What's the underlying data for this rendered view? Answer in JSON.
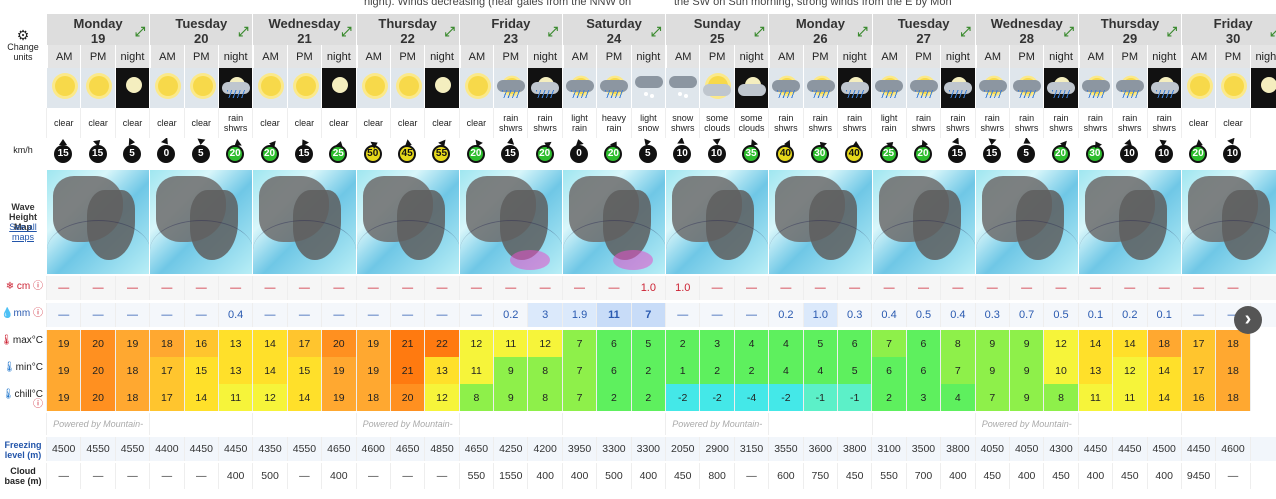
{
  "top_text": [
    {
      "text": "night). Winds decreasing (near gales from the NNW on",
      "x": 0
    },
    {
      "text": "the SW on Sun morning, strong winds from the E by Mon",
      "x": 0
    }
  ],
  "labels": {
    "change_units": "Change units",
    "wind": "km/h",
    "wave_map": "Wave Height Map",
    "see_all": "See all maps",
    "snow": "cm",
    "rain": "mm",
    "max": "max°C",
    "min": "min°C",
    "chill": "chill°C",
    "freezing": "Freezing level (m)",
    "cloud_base": "Cloud base (m)",
    "powered": "Powered by Mountain-Forecast.com",
    "tod": [
      "AM",
      "PM",
      "night"
    ]
  },
  "days": [
    {
      "name": "Monday",
      "date": "19"
    },
    {
      "name": "Tuesday",
      "date": "20"
    },
    {
      "name": "Wednesday",
      "date": "21"
    },
    {
      "name": "Thursday",
      "date": "22"
    },
    {
      "name": "Friday",
      "date": "23"
    },
    {
      "name": "Saturday",
      "date": "24"
    },
    {
      "name": "Sunday",
      "date": "25"
    },
    {
      "name": "Monday",
      "date": "26"
    },
    {
      "name": "Tuesday",
      "date": "27"
    },
    {
      "name": "Wednesday",
      "date": "28"
    },
    {
      "name": "Thursday",
      "date": "29"
    },
    {
      "name": "Friday",
      "date": "30"
    }
  ],
  "periods": [
    {
      "icon": "sun",
      "desc": "clear",
      "wind": "15",
      "snow": "—",
      "rain": "—",
      "max": "19",
      "min": "19",
      "chill": "19",
      "fz": "4500",
      "cb": "—"
    },
    {
      "icon": "sun",
      "desc": "clear",
      "wind": "15",
      "snow": "—",
      "rain": "—",
      "max": "20",
      "min": "20",
      "chill": "20",
      "fz": "4550",
      "cb": "—"
    },
    {
      "icon": "moon",
      "desc": "clear",
      "wind": "5",
      "snow": "—",
      "rain": "—",
      "max": "19",
      "min": "18",
      "chill": "18",
      "fz": "4550",
      "cb": "—"
    },
    {
      "icon": "sun",
      "desc": "clear",
      "wind": "0",
      "snow": "—",
      "rain": "—",
      "max": "18",
      "min": "17",
      "chill": "17",
      "fz": "4400",
      "cb": "—"
    },
    {
      "icon": "sun",
      "desc": "clear",
      "wind": "5",
      "snow": "—",
      "rain": "—",
      "max": "16",
      "min": "15",
      "chill": "14",
      "fz": "4450",
      "cb": "—"
    },
    {
      "icon": "moonrain",
      "desc": "rain shwrs",
      "wind": "20",
      "snow": "—",
      "rain": "0.4",
      "max": "13",
      "min": "13",
      "chill": "11",
      "fz": "4450",
      "cb": "400"
    },
    {
      "icon": "sun",
      "desc": "clear",
      "wind": "20",
      "snow": "—",
      "rain": "—",
      "max": "14",
      "min": "14",
      "chill": "12",
      "fz": "4350",
      "cb": "500"
    },
    {
      "icon": "sun",
      "desc": "clear",
      "wind": "15",
      "snow": "—",
      "rain": "—",
      "max": "17",
      "min": "15",
      "chill": "14",
      "fz": "4550",
      "cb": "—"
    },
    {
      "icon": "moon",
      "desc": "clear",
      "wind": "25",
      "snow": "—",
      "rain": "—",
      "max": "20",
      "min": "19",
      "chill": "19",
      "fz": "4650",
      "cb": "400"
    },
    {
      "icon": "sun",
      "desc": "clear",
      "wind": "50",
      "snow": "—",
      "rain": "—",
      "max": "19",
      "min": "19",
      "chill": "18",
      "fz": "4600",
      "cb": "—"
    },
    {
      "icon": "sun",
      "desc": "clear",
      "wind": "45",
      "snow": "—",
      "rain": "—",
      "max": "21",
      "min": "21",
      "chill": "20",
      "fz": "4650",
      "cb": "—"
    },
    {
      "icon": "moon",
      "desc": "clear",
      "wind": "55",
      "snow": "—",
      "rain": "—",
      "max": "22",
      "min": "13",
      "chill": "12",
      "fz": "4850",
      "cb": "—"
    },
    {
      "icon": "sun",
      "desc": "clear",
      "wind": "20",
      "snow": "—",
      "rain": "—",
      "max": "12",
      "min": "11",
      "chill": "8",
      "fz": "4650",
      "cb": "550"
    },
    {
      "icon": "cloudrain",
      "desc": "rain shwrs",
      "wind": "15",
      "snow": "—",
      "rain": "0.2",
      "max": "11",
      "min": "9",
      "chill": "9",
      "fz": "4250",
      "cb": "1550"
    },
    {
      "icon": "moonrain",
      "desc": "rain shwrs",
      "wind": "20",
      "snow": "—",
      "rain": "3",
      "max": "12",
      "min": "8",
      "chill": "8",
      "fz": "4200",
      "cb": "400"
    },
    {
      "icon": "cloudrain",
      "desc": "light rain",
      "wind": "0",
      "snow": "—",
      "rain": "1.9",
      "max": "7",
      "min": "7",
      "chill": "7",
      "fz": "3950",
      "cb": "400"
    },
    {
      "icon": "cloudrain",
      "desc": "heavy rain",
      "wind": "20",
      "snow": "—",
      "rain": "11",
      "max": "6",
      "min": "6",
      "chill": "2",
      "fz": "3300",
      "cb": "500"
    },
    {
      "icon": "cloudsnow",
      "desc": "light snow",
      "wind": "5",
      "snow": "1.0",
      "rain": "7",
      "max": "5",
      "min": "2",
      "chill": "2",
      "fz": "3300",
      "cb": "400"
    },
    {
      "icon": "cloudsnow",
      "desc": "snow shwrs",
      "wind": "10",
      "snow": "1.0",
      "rain": "—",
      "max": "2",
      "min": "1",
      "chill": "-2",
      "fz": "2050",
      "cb": "450"
    },
    {
      "icon": "suncloud",
      "desc": "some clouds",
      "wind": "10",
      "snow": "—",
      "rain": "—",
      "max": "3",
      "min": "2",
      "chill": "-2",
      "fz": "2900",
      "cb": "800"
    },
    {
      "icon": "mooncloud",
      "desc": "some clouds",
      "wind": "35",
      "snow": "—",
      "rain": "—",
      "max": "4",
      "min": "2",
      "chill": "-4",
      "fz": "3150",
      "cb": "—"
    },
    {
      "icon": "cloudrain",
      "desc": "rain shwrs",
      "wind": "40",
      "snow": "—",
      "rain": "0.2",
      "max": "4",
      "min": "4",
      "chill": "-2",
      "fz": "3550",
      "cb": "600"
    },
    {
      "icon": "cloudrain",
      "desc": "rain shwrs",
      "wind": "30",
      "snow": "—",
      "rain": "1.0",
      "max": "5",
      "min": "4",
      "chill": "-1",
      "fz": "3600",
      "cb": "750"
    },
    {
      "icon": "moonrain",
      "desc": "rain shwrs",
      "wind": "40",
      "snow": "—",
      "rain": "0.3",
      "max": "6",
      "min": "5",
      "chill": "-1",
      "fz": "3800",
      "cb": "450"
    },
    {
      "icon": "cloudrain",
      "desc": "light rain",
      "wind": "25",
      "snow": "—",
      "rain": "0.4",
      "max": "7",
      "min": "6",
      "chill": "2",
      "fz": "3100",
      "cb": "550"
    },
    {
      "icon": "cloudrain",
      "desc": "rain shwrs",
      "wind": "20",
      "snow": "—",
      "rain": "0.5",
      "max": "6",
      "min": "6",
      "chill": "3",
      "fz": "3500",
      "cb": "700"
    },
    {
      "icon": "moonrain",
      "desc": "rain shwrs",
      "wind": "15",
      "snow": "—",
      "rain": "0.4",
      "max": "8",
      "min": "7",
      "chill": "4",
      "fz": "3800",
      "cb": "400"
    },
    {
      "icon": "cloudrain",
      "desc": "rain shwrs",
      "wind": "15",
      "snow": "—",
      "rain": "0.3",
      "max": "9",
      "min": "9",
      "chill": "7",
      "fz": "4050",
      "cb": "450"
    },
    {
      "icon": "cloudrain",
      "desc": "rain shwrs",
      "wind": "5",
      "snow": "—",
      "rain": "0.7",
      "max": "9",
      "min": "9",
      "chill": "9",
      "fz": "4050",
      "cb": "400"
    },
    {
      "icon": "moonrain",
      "desc": "rain shwrs",
      "wind": "20",
      "snow": "—",
      "rain": "0.5",
      "max": "12",
      "min": "10",
      "chill": "8",
      "fz": "4300",
      "cb": "450"
    },
    {
      "icon": "cloudrain",
      "desc": "rain shwrs",
      "wind": "30",
      "snow": "—",
      "rain": "0.1",
      "max": "14",
      "min": "13",
      "chill": "11",
      "fz": "4450",
      "cb": "400"
    },
    {
      "icon": "cloudrain",
      "desc": "rain shwrs",
      "wind": "10",
      "snow": "—",
      "rain": "0.2",
      "max": "14",
      "min": "12",
      "chill": "11",
      "fz": "4450",
      "cb": "450"
    },
    {
      "icon": "moonrain",
      "desc": "rain shwrs",
      "wind": "10",
      "snow": "—",
      "rain": "0.1",
      "max": "18",
      "min": "14",
      "chill": "14",
      "fz": "4500",
      "cb": "400"
    },
    {
      "icon": "sun",
      "desc": "clear",
      "wind": "20",
      "snow": "—",
      "rain": "—",
      "max": "17",
      "min": "17",
      "chill": "16",
      "fz": "4450",
      "cb": "9450"
    },
    {
      "icon": "sun",
      "desc": "clear",
      "wind": "10",
      "snow": "—",
      "rain": "—",
      "max": "18",
      "min": "18",
      "chill": "18",
      "fz": "4600",
      "cb": "—"
    },
    {
      "icon": "moon",
      "desc": "",
      "wind": "",
      "snow": "",
      "rain": "",
      "max": "",
      "min": "",
      "chill": "",
      "fz": "",
      "cb": ""
    }
  ]
}
